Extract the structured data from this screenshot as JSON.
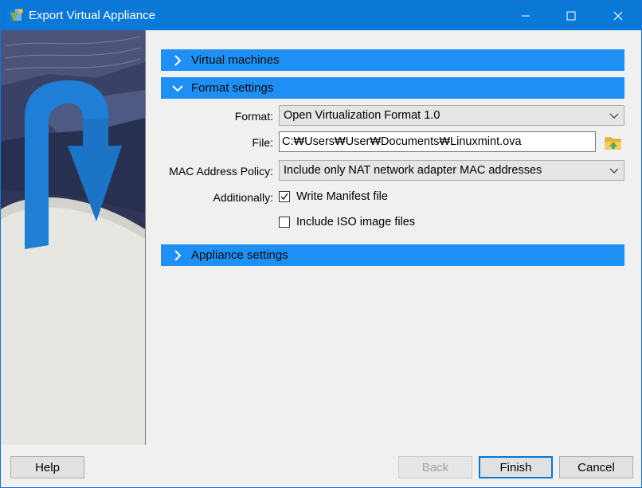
{
  "window": {
    "title": "Export Virtual Appliance"
  },
  "sections": {
    "virtual_machines": {
      "label": "Virtual machines",
      "expanded": false
    },
    "format_settings": {
      "label": "Format settings",
      "expanded": true
    },
    "appliance_settings": {
      "label": "Appliance settings",
      "expanded": false
    }
  },
  "format": {
    "format_label": "Format:",
    "format_value": "Open Virtualization Format 1.0",
    "file_label": "File:",
    "file_value": "C:₩Users₩User₩Documents₩Linuxmint.ova",
    "mac_label": "MAC Address Policy:",
    "mac_value": "Include only NAT network adapter MAC addresses",
    "additionally_label": "Additionally:",
    "write_manifest_label": "Write Manifest file",
    "write_manifest_checked": true,
    "include_iso_label": "Include ISO image files",
    "include_iso_checked": false
  },
  "buttons": {
    "help": "Help",
    "back": "Back",
    "finish": "Finish",
    "cancel": "Cancel"
  },
  "icons": {
    "app": "virtualbox-icon",
    "folder": "folder-open-icon",
    "minimize": "minimize-icon",
    "maximize": "maximize-icon",
    "close": "close-icon"
  },
  "colors": {
    "titlebar": "#0a78d7",
    "section_header": "#1e90f5",
    "default_button_border": "#0078d7"
  }
}
